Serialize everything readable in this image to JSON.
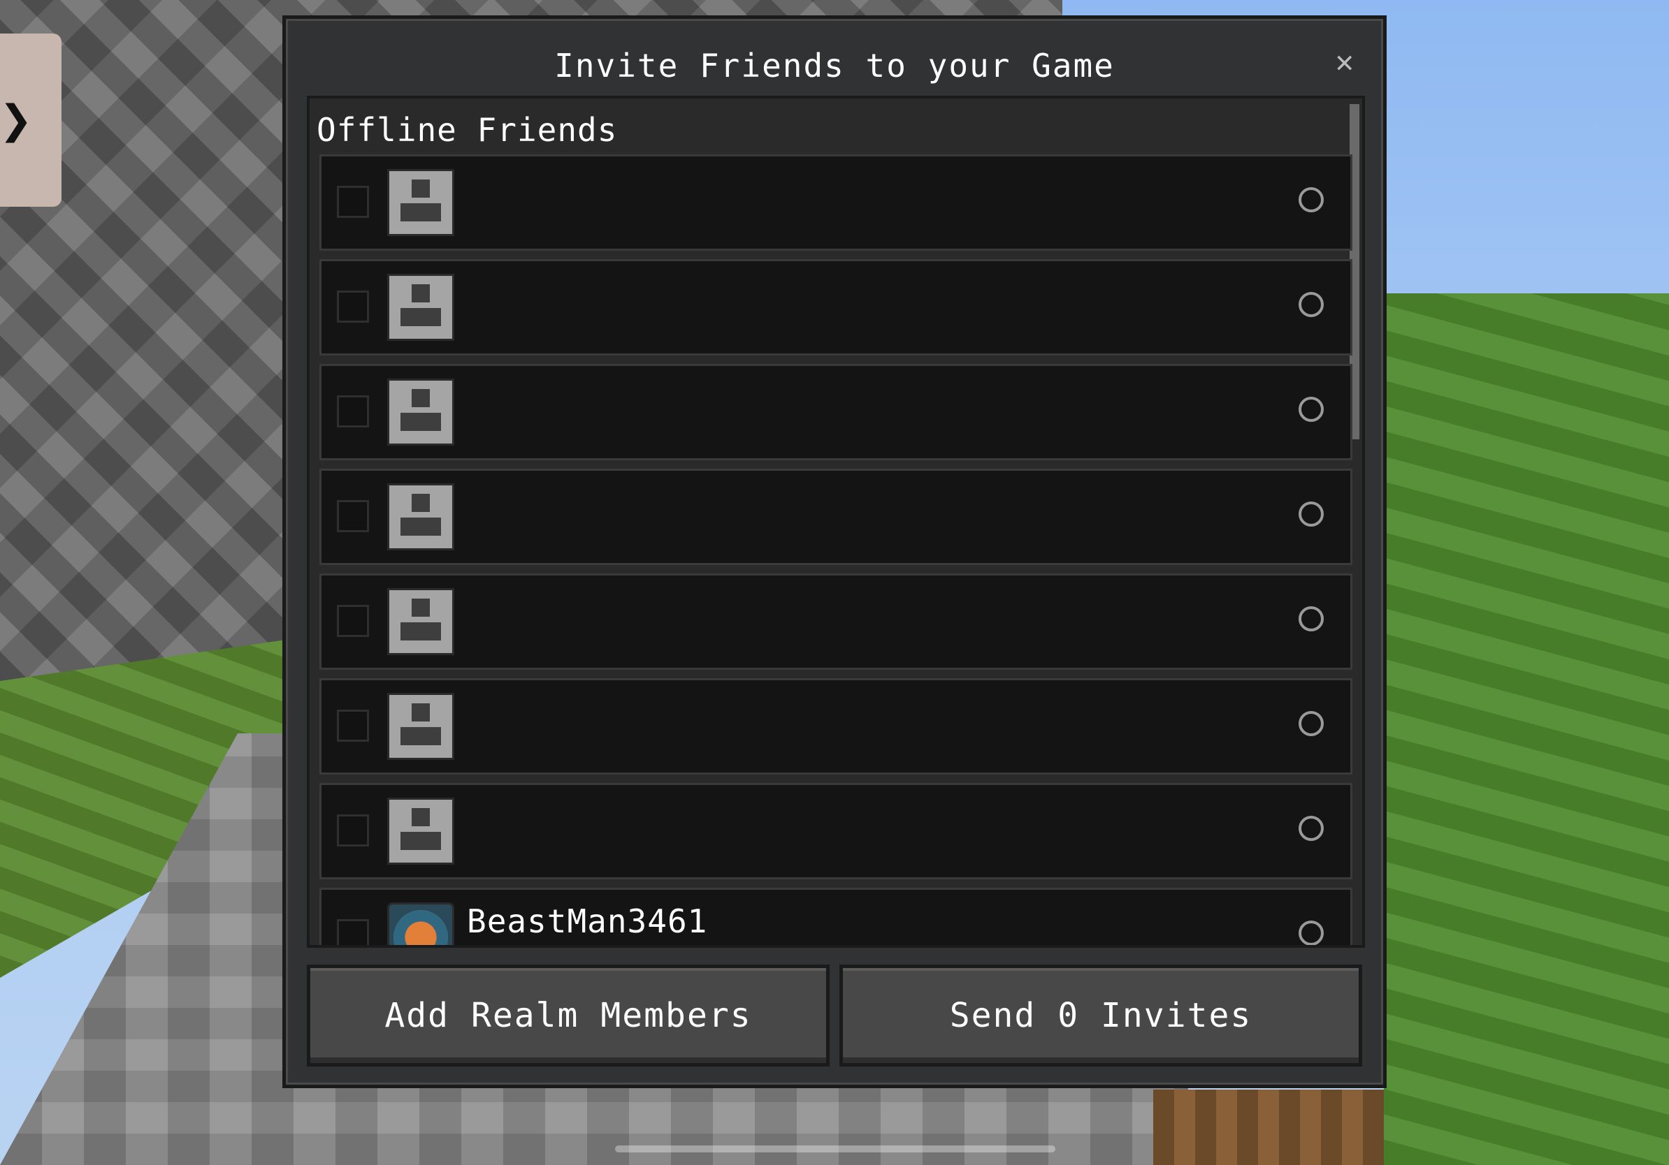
{
  "side_toggle": {
    "glyph": "❯"
  },
  "dialog": {
    "title": "Invite Friends to your Game",
    "close_glyph": "✕",
    "section_header": "Offline Friends",
    "friends": [
      {
        "name": ""
      },
      {
        "name": ""
      },
      {
        "name": ""
      },
      {
        "name": ""
      },
      {
        "name": ""
      },
      {
        "name": ""
      },
      {
        "name": ""
      },
      {
        "name": "BeastMan3461"
      }
    ],
    "buttons": {
      "add_realm_members": "Add Realm Members",
      "send_invites": "Send 0 Invites"
    }
  },
  "colors": {
    "dialog_bg": "#313233",
    "row_bg": "#141414",
    "button_bg": "#484849"
  }
}
